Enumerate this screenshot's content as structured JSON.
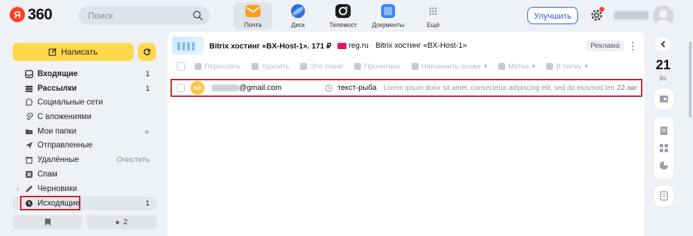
{
  "header": {
    "logo_text": "360",
    "logo_letter": "Я",
    "search_placeholder": "Поиск",
    "apps": [
      {
        "label": "Почта",
        "color": "#ff9e1b"
      },
      {
        "label": "Диск",
        "color": "#2f6fe0"
      },
      {
        "label": "Телемост",
        "color": "#1b1b1b"
      },
      {
        "label": "Документы",
        "color": "#3b82f6"
      },
      {
        "label": "Ещё",
        "color": "#b8bcc4"
      }
    ],
    "upgrade_label": "Улучшить"
  },
  "sidebar": {
    "compose_label": "Написать",
    "folders": [
      {
        "label": "Входящие",
        "count": "1",
        "icon": "inbox-icon"
      },
      {
        "label": "Рассылки",
        "count": "1",
        "icon": "newsletters-icon"
      },
      {
        "label": "Социальные сети",
        "count": "",
        "icon": "social-icon"
      },
      {
        "label": "С вложениями",
        "count": "",
        "icon": "attachment-icon"
      },
      {
        "label": "Мои папки",
        "count": "+",
        "icon": "folder-icon"
      },
      {
        "label": "Отправленные",
        "count": "",
        "icon": "send-icon"
      },
      {
        "label": "Удалённые",
        "count": "Очистить",
        "icon": "trash-icon"
      },
      {
        "label": "Спам",
        "count": "",
        "icon": "spam-icon"
      },
      {
        "label": "Черновики",
        "count": "",
        "icon": "pencil-icon"
      },
      {
        "label": "Исходящие",
        "count": "1",
        "icon": "clock-icon"
      }
    ],
    "bottom_count": "2"
  },
  "ad": {
    "title": "Bitrix хостинг «BX-Host-1». 171 ₽",
    "site": "reg.ru",
    "text": "Bitrix хостинг «BX-Host-1»",
    "badge": "Реклама"
  },
  "toolbar": {
    "items": [
      "Переслать",
      "Удалить",
      "Это спам!",
      "Прочитано",
      "Напомнить позже",
      "Метка",
      "В папку"
    ]
  },
  "message": {
    "avatar_initials": "НА",
    "from_domain": "@gmail.com",
    "subject": "текст-рыба",
    "preview": "Lorem ipsum dolor sit amet, consectetur adipiscing elit, sed do eiusmod tem...",
    "date": "22 авг"
  },
  "rail": {
    "day": "21",
    "weekday": "Вс"
  },
  "colors": {
    "accent_yellow": "#ffd84c",
    "highlight_red": "#c8202a",
    "link_blue": "#2c5ad4"
  }
}
